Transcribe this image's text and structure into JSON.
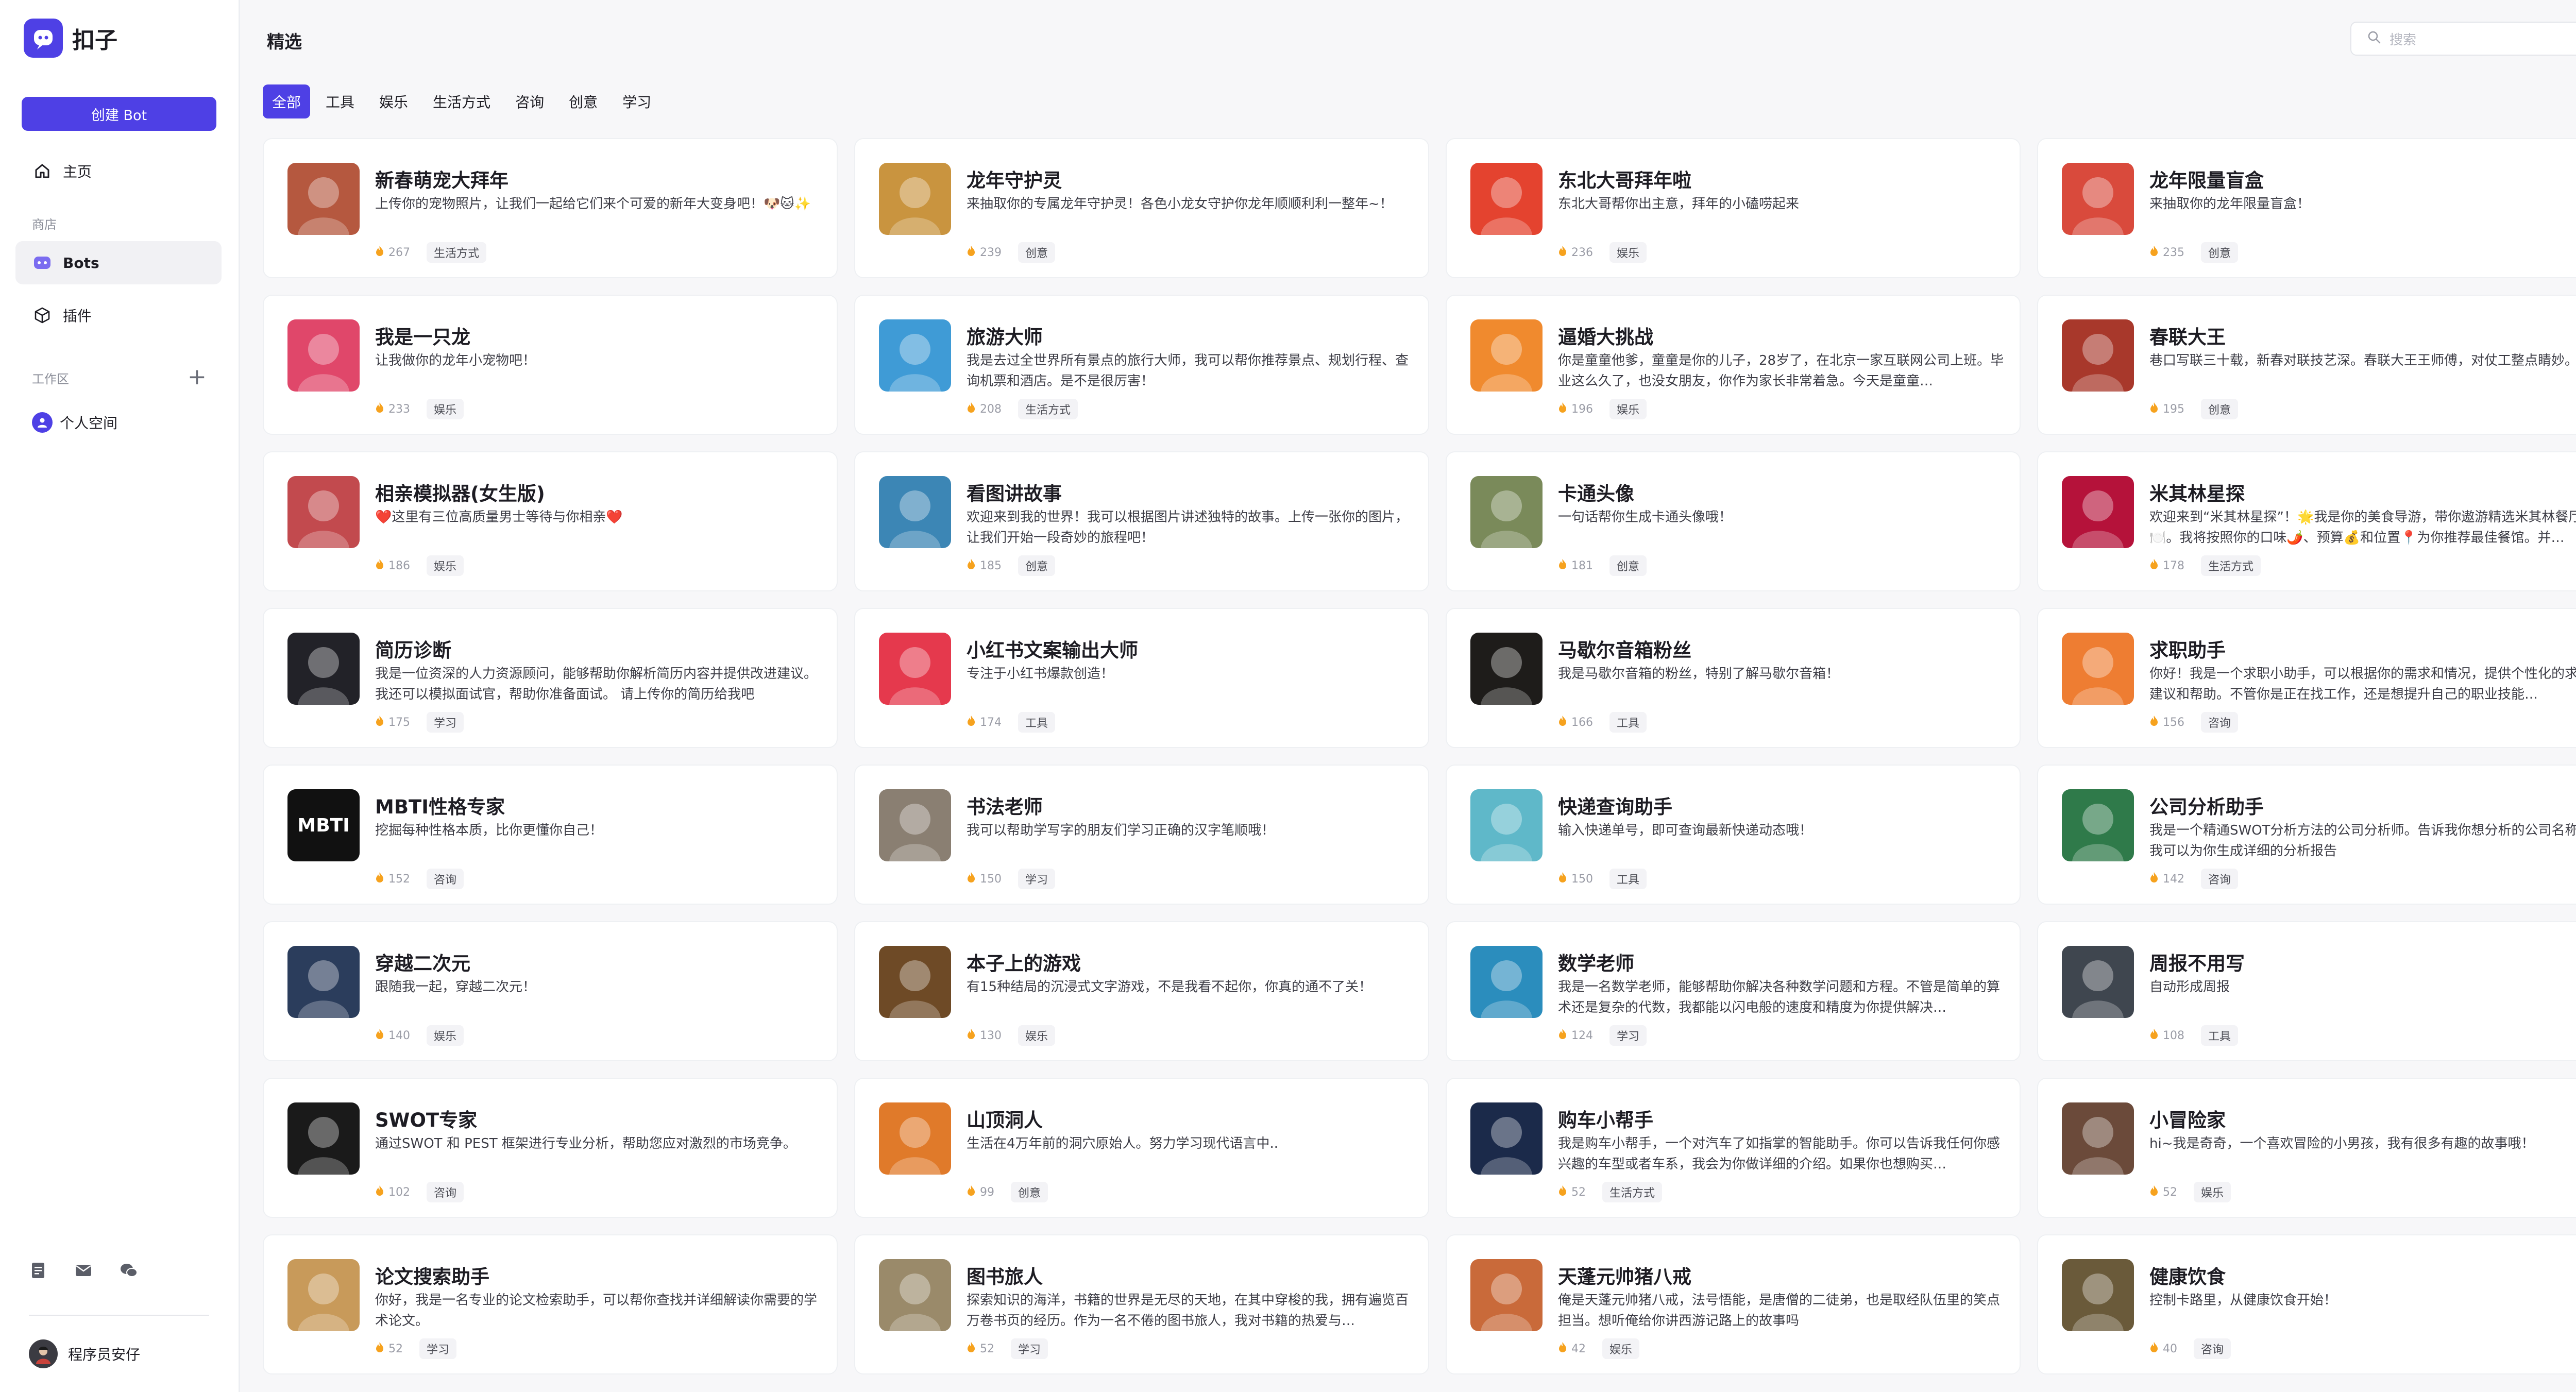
{
  "app": {
    "logo_text": "扣子"
  },
  "sidebar": {
    "create_button": "创建 Bot",
    "home": "主页",
    "store_label": "商店",
    "bots": "Bots",
    "plugins": "插件",
    "workspace_label": "工作区",
    "workspace_add": "+",
    "personal_space": "个人空间",
    "user_name": "程序员安仔"
  },
  "header": {
    "title": "精选",
    "search_placeholder": "搜索"
  },
  "tabs": [
    "全部",
    "工具",
    "娱乐",
    "生活方式",
    "咨询",
    "创意",
    "学习"
  ],
  "colors": {
    "accent": "#4e40e5",
    "flame": "#f6a21e"
  },
  "bots": [
    {
      "title": "新春萌宠大拜年",
      "desc": "上传你的宠物照片，让我们一起给它们来个可爱的新年大变身吧！🐶🐱✨",
      "count": "267",
      "tag": "生活方式",
      "color": "#b5583f"
    },
    {
      "title": "龙年守护灵",
      "desc": "来抽取你的专属龙年守护灵！各色小龙女守护你龙年顺顺利利一整年~！",
      "count": "239",
      "tag": "创意",
      "color": "#c9943f"
    },
    {
      "title": "东北大哥拜年啦",
      "desc": "东北大哥帮你出主意，拜年的小磕唠起来",
      "count": "236",
      "tag": "娱乐",
      "color": "#e4432f"
    },
    {
      "title": "龙年限量盲盒",
      "desc": "来抽取你的龙年限量盲盒！",
      "count": "235",
      "tag": "创意",
      "color": "#d94a3c"
    },
    {
      "title": "我是一只龙",
      "desc": "让我做你的龙年小宠物吧！",
      "count": "233",
      "tag": "娱乐",
      "color": "#e0476a"
    },
    {
      "title": "旅游大师",
      "desc": "我是去过全世界所有景点的旅行大师，我可以帮你推荐景点、规划行程、查询机票和酒店。是不是很厉害！",
      "count": "208",
      "tag": "生活方式",
      "color": "#3f9bd6"
    },
    {
      "title": "逼婚大挑战",
      "desc": "你是童童他爹，童童是你的儿子，28岁了，在北京一家互联网公司上班。毕业这么久了，也没女朋友，你作为家长非常着急。今天是童童…",
      "count": "196",
      "tag": "娱乐",
      "color": "#f08a2e"
    },
    {
      "title": "春联大王",
      "desc": "巷口写联三十载，新春对联技艺深。春联大王王师傅，对仗工整点睛妙。",
      "count": "195",
      "tag": "创意",
      "color": "#a8382b"
    },
    {
      "title": "相亲模拟器(女生版)",
      "desc": "❤️这里有三位高质量男士等待与你相亲❤️",
      "count": "186",
      "tag": "娱乐",
      "color": "#c24a4e"
    },
    {
      "title": "看图讲故事",
      "desc": "欢迎来到我的世界！我可以根据图片讲述独特的故事。上传一张你的图片，让我们开始一段奇妙的旅程吧！",
      "count": "185",
      "tag": "创意",
      "color": "#3c86b5"
    },
    {
      "title": "卡通头像",
      "desc": "一句话帮你生成卡通头像哦！",
      "count": "181",
      "tag": "创意",
      "color": "#7a8a5a"
    },
    {
      "title": "米其林星探",
      "desc": "欢迎来到“米其林星探”！🌟我是你的美食导游，带你遨游精选米其林餐厅🍽️。我将按照你的口味🌶️、预算💰和位置📍为你推荐最佳餐馆。并…",
      "count": "178",
      "tag": "生活方式",
      "color": "#b5123a"
    },
    {
      "title": "简历诊断",
      "desc": "我是一位资深的人力资源顾问，能够帮助你解析简历内容并提供改进建议。我还可以模拟面试官，帮助你准备面试。 请上传你的简历给我吧",
      "count": "175",
      "tag": "学习",
      "color": "#222228"
    },
    {
      "title": "小红书文案输出大师",
      "desc": "专注于小红书爆款创造！",
      "count": "174",
      "tag": "工具",
      "color": "#e5394d"
    },
    {
      "title": "马歇尔音箱粉丝",
      "desc": "我是马歇尔音箱的粉丝，特别了解马歇尔音箱！",
      "count": "166",
      "tag": "工具",
      "color": "#1e1c1a"
    },
    {
      "title": "求职助手",
      "desc": "你好！我是一个求职小助手，可以根据你的需求和情况，提供个性化的求职建议和帮助。不管你是正在找工作，还是想提升自己的职业技能…",
      "count": "156",
      "tag": "咨询",
      "color": "#ee7d32"
    },
    {
      "title": "MBTI性格专家",
      "desc": "挖掘每种性格本质，比你更懂你自己！",
      "count": "152",
      "tag": "咨询",
      "color": "#111111",
      "img_text": "MBTI"
    },
    {
      "title": "书法老师",
      "desc": "我可以帮助学写字的朋友们学习正确的汉字笔顺哦！",
      "count": "150",
      "tag": "学习",
      "color": "#8a7f72"
    },
    {
      "title": "快递查询助手",
      "desc": "输入快递单号，即可查询最新快递动态哦！",
      "count": "150",
      "tag": "工具",
      "color": "#5fb8c9"
    },
    {
      "title": "公司分析助手",
      "desc": "我是一个精通SWOT分析方法的公司分析师。告诉我你想分析的公司名称，我可以为你生成详细的分析报告",
      "count": "142",
      "tag": "咨询",
      "color": "#2f7a4a"
    },
    {
      "title": "穿越二次元",
      "desc": "跟随我一起，穿越二次元！",
      "count": "140",
      "tag": "娱乐",
      "color": "#2b3d5c"
    },
    {
      "title": "本子上的游戏",
      "desc": "有15种结局的沉浸式文字游戏，不是我看不起你，你真的通不了关！",
      "count": "130",
      "tag": "娱乐",
      "color": "#6e4a26"
    },
    {
      "title": "数学老师",
      "desc": "我是一名数学老师，能够帮助你解决各种数学问题和方程。不管是简单的算术还是复杂的代数，我都能以闪电般的速度和精度为你提供解决…",
      "count": "124",
      "tag": "学习",
      "color": "#2b8dbd"
    },
    {
      "title": "周报不用写",
      "desc": "自动形成周报",
      "count": "108",
      "tag": "工具",
      "color": "#3f464f"
    },
    {
      "title": "SWOT专家",
      "desc": "通过SWOT 和 PEST 框架进行专业分析，帮助您应对激烈的市场竞争。",
      "count": "102",
      "tag": "咨询",
      "color": "#1a1a1a"
    },
    {
      "title": "山顶洞人",
      "desc": "生活在4万年前的洞穴原始人。努力学习现代语言中..",
      "count": "99",
      "tag": "创意",
      "color": "#e07a2a"
    },
    {
      "title": "购车小帮手",
      "desc": "我是购车小帮手，一个对汽车了如指掌的智能助手。你可以告诉我任何你感兴趣的车型或者车系，我会为你做详细的介绍。如果你也想购买…",
      "count": "52",
      "tag": "生活方式",
      "color": "#1b2a4a"
    },
    {
      "title": "小冒险家",
      "desc": "hi~我是奇奇，一个喜欢冒险的小男孩，我有很多有趣的故事哦！",
      "count": "52",
      "tag": "娱乐",
      "color": "#6b4a3a"
    },
    {
      "title": "论文搜索助手",
      "desc": "你好，我是一名专业的论文检索助手，可以帮你查找并详细解读你需要的学术论文。",
      "count": "52",
      "tag": "学习",
      "color": "#c89a5a"
    },
    {
      "title": "图书旅人",
      "desc": "探索知识的海洋，书籍的世界是无尽的天地，在其中穿梭的我，拥有遍览百万卷书页的经历。作为一名不倦的图书旅人，我对书籍的热爱与…",
      "count": "52",
      "tag": "学习",
      "color": "#9a8a6a"
    },
    {
      "title": "天蓬元帅猪八戒",
      "desc": "俺是天蓬元帅猪八戒，法号悟能，是唐僧的二徒弟，也是取经队伍里的笑点担当。想听俺给你讲西游记路上的故事吗",
      "count": "42",
      "tag": "娱乐",
      "color": "#c96a3a"
    },
    {
      "title": "健康饮食",
      "desc": "控制卡路里，从健康饮食开始！",
      "count": "40",
      "tag": "咨询",
      "color": "#6a5a3a"
    }
  ]
}
